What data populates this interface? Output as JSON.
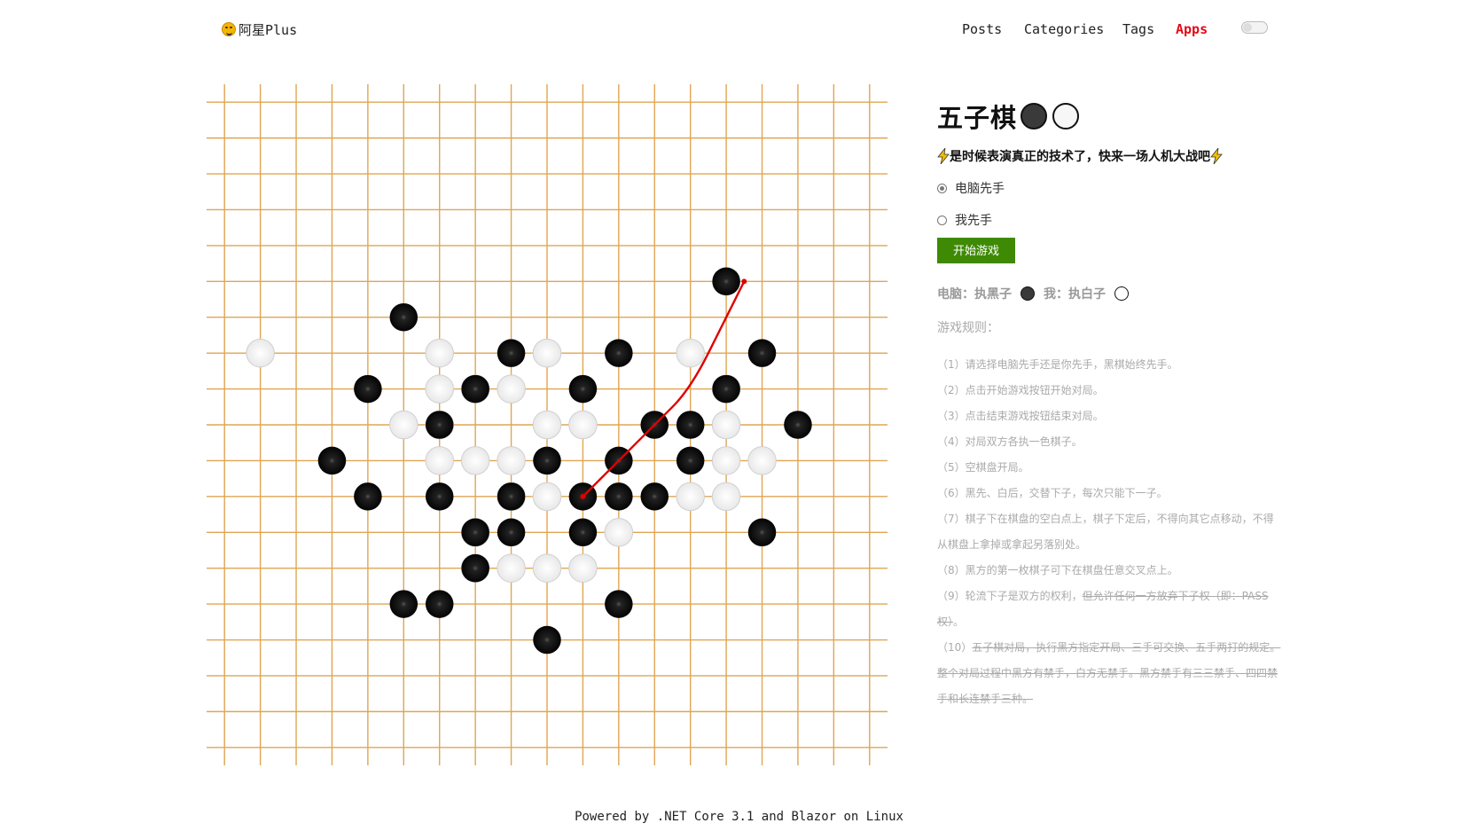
{
  "site": {
    "brand": "阿星Plus"
  },
  "nav": {
    "items": [
      {
        "label": "Posts",
        "active": false
      },
      {
        "label": "Categories",
        "active": false
      },
      {
        "label": "Tags",
        "active": false
      },
      {
        "label": "Apps",
        "active": true
      }
    ]
  },
  "game": {
    "title": "五子棋",
    "subtitle": "是时候表演真正的技术了，快来一场人机大战吧",
    "options": [
      {
        "label": "电脑先手",
        "checked": true
      },
      {
        "label": "我先手",
        "checked": false
      }
    ],
    "start_button": "开始游戏",
    "computer_label": "电脑：执黑子",
    "me_label": "我：执白子",
    "rules_title": "游戏规则：",
    "rules": [
      {
        "text": "（1）请选择电脑先手还是你先手，黑棋始终先手。"
      },
      {
        "text": "（2）点击开始游戏按钮开始对局。"
      },
      {
        "text": "（3）点击结束游戏按钮结束对局。"
      },
      {
        "text": "（4）对局双方各执一色棋子。"
      },
      {
        "text": "（5）空棋盘开局。"
      },
      {
        "text": "（6）黑先、白后，交替下子，每次只能下一子。"
      },
      {
        "text": "（7）棋子下在棋盘的空白点上，棋子下定后，不得向其它点移动，不得从棋盘上拿掉或拿起另落别处。"
      },
      {
        "text": "（8）黑方的第一枚棋子可下在棋盘任意交叉点上。"
      },
      {
        "text": "（9）轮流下子是双方的权利，",
        "strike": "但允许任何一方放弃下子权（即：PASS权）",
        "after": "。"
      },
      {
        "text": "（10）",
        "strike": "五子棋对局，执行黑方指定开局、三手可交换、五手两打的规定。整个对局过程中黑方有禁手，白方无禁手。黑方禁手有三三禁手、四四禁手和长连禁手三种。",
        "after": ""
      }
    ]
  },
  "board": {
    "size": 19,
    "colors": {
      "line": "#e0a553",
      "black": "#111111",
      "white": "#f2f2f2",
      "win_line": "#e00000"
    },
    "black_stones": [
      [
        5,
        6
      ],
      [
        14,
        5
      ],
      [
        8,
        7
      ],
      [
        11,
        7
      ],
      [
        15,
        7
      ],
      [
        4,
        8
      ],
      [
        7,
        8
      ],
      [
        10,
        8
      ],
      [
        14,
        8
      ],
      [
        6,
        9
      ],
      [
        12,
        9
      ],
      [
        13,
        9
      ],
      [
        16,
        9
      ],
      [
        3,
        10
      ],
      [
        9,
        10
      ],
      [
        11,
        10
      ],
      [
        13,
        10
      ],
      [
        4,
        11
      ],
      [
        6,
        11
      ],
      [
        8,
        11
      ],
      [
        10,
        11
      ],
      [
        11,
        11
      ],
      [
        12,
        11
      ],
      [
        7,
        12
      ],
      [
        8,
        12
      ],
      [
        10,
        12
      ],
      [
        15,
        12
      ],
      [
        7,
        13
      ],
      [
        5,
        14
      ],
      [
        6,
        14
      ],
      [
        11,
        14
      ],
      [
        9,
        15
      ]
    ],
    "white_stones": [
      [
        1,
        7
      ],
      [
        6,
        7
      ],
      [
        9,
        7
      ],
      [
        13,
        7
      ],
      [
        6,
        8
      ],
      [
        7,
        8
      ],
      [
        8,
        8
      ],
      [
        14,
        8
      ],
      [
        5,
        9
      ],
      [
        6,
        9
      ],
      [
        9,
        9
      ],
      [
        10,
        9
      ],
      [
        14,
        9
      ],
      [
        6,
        10
      ],
      [
        7,
        10
      ],
      [
        8,
        10
      ],
      [
        14,
        10
      ],
      [
        15,
        10
      ],
      [
        8,
        11
      ],
      [
        9,
        11
      ],
      [
        13,
        11
      ],
      [
        14,
        11
      ],
      [
        7,
        12
      ],
      [
        11,
        12
      ],
      [
        7,
        13
      ],
      [
        8,
        13
      ],
      [
        9,
        13
      ],
      [
        10,
        13
      ]
    ],
    "win_path": [
      [
        10,
        11
      ],
      [
        11,
        10
      ],
      [
        12,
        9
      ],
      [
        13,
        8
      ],
      [
        14,
        6
      ],
      [
        14.5,
        5
      ]
    ]
  },
  "footer": {
    "text": "Powered by .NET Core 3.1 and Blazor on Linux"
  }
}
